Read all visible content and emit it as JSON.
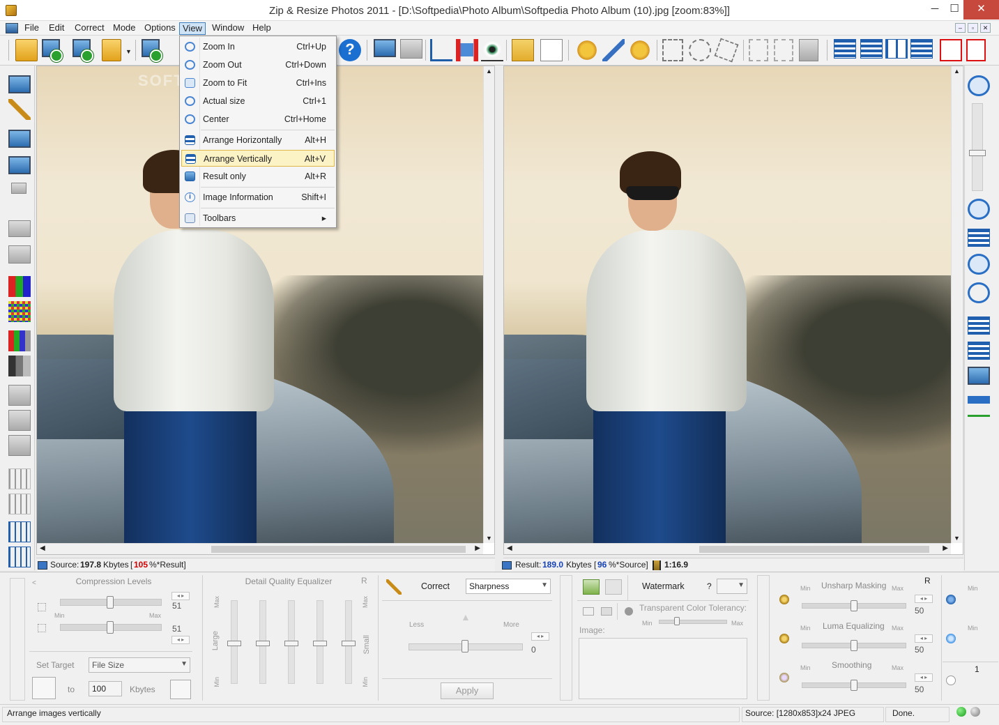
{
  "window": {
    "title": "Zip & Resize Photos 2011 - [D:\\Softpedia\\Photo Album\\Softpedia Photo Album (10).jpg  [zoom:83%]]",
    "minimize": "─",
    "maximize": "☐",
    "close": "✕"
  },
  "menu": [
    "File",
    "Edit",
    "Correct",
    "Mode",
    "Options",
    "View",
    "Window",
    "Help"
  ],
  "mdi_buttons": [
    "–",
    "▫",
    "✕"
  ],
  "view_menu": [
    {
      "label": "Zoom In",
      "shortcut": "Ctrl+Up",
      "icon": "zoom-in-icon"
    },
    {
      "label": "Zoom Out",
      "shortcut": "Ctrl+Down",
      "icon": "zoom-out-icon"
    },
    {
      "label": "Zoom to Fit",
      "shortcut": "Ctrl+Ins",
      "icon": "zoom-fit-icon"
    },
    {
      "label": "Actual size",
      "shortcut": "Ctrl+1",
      "icon": "actual-size-icon"
    },
    {
      "label": "Center",
      "shortcut": "Ctrl+Home",
      "icon": "center-icon"
    },
    {
      "label": "Arrange Horizontally",
      "shortcut": "Alt+H",
      "icon": "arrange-horizontal-icon"
    },
    {
      "label": "Arrange Vertically",
      "shortcut": "Alt+V",
      "icon": "arrange-vertical-icon"
    },
    {
      "label": "Result only",
      "shortcut": "Alt+R",
      "icon": "result-only-icon"
    },
    {
      "label": "Image Information",
      "shortcut": "Shift+I",
      "icon": "info-icon"
    },
    {
      "label": "Toolbars",
      "shortcut": "▸",
      "icon": "toolbars-icon"
    }
  ],
  "watermark_text": "SOFTPEDIA",
  "source_bar": {
    "prefix": "Source:",
    "size": "197.8",
    "unit": "Kbytes",
    "bracket_open": "[",
    "pct": "105",
    "suffix": "%*Result]"
  },
  "result_bar": {
    "prefix": "Result:",
    "size": "189.0",
    "unit": "Kbytes",
    "bracket_open": "[",
    "pct": "96",
    "suffix": "%*Source]",
    "ratio": "1:16.9"
  },
  "compression": {
    "title": "Compression Levels",
    "min": "Min",
    "max": "Max",
    "val1": "51",
    "val2": "51",
    "set_target": "Set Target",
    "target_type": "File Size",
    "to": "to",
    "target_value": "100",
    "unit": "Kbytes"
  },
  "detail_eq": {
    "title": "Detail Quality Equalizer",
    "r": "R",
    "max": "Max",
    "large": "Large",
    "min": "Min",
    "small": "Small"
  },
  "correct": {
    "label": "Correct",
    "option": "Sharpness",
    "less": "Less",
    "more": "More",
    "value": "0",
    "apply": "Apply"
  },
  "watermark": {
    "label": "Watermark",
    "q": "?",
    "tolerance": "Transparent Color Tolerancy:",
    "min": "Min",
    "max": "Max",
    "image": "Image:"
  },
  "filters": {
    "r": "R",
    "unsharp": "Unsharp Masking",
    "luma": "Luma Equalizing",
    "smoothing": "Smoothing",
    "min": "Min",
    "max": "Max",
    "v1": "50",
    "v2": "50",
    "v3": "50"
  },
  "far_right": {
    "min": "Min",
    "one": "1"
  },
  "status": {
    "hint": "Arrange images vertically",
    "source_info": "Source: [1280x853]x24 JPEG",
    "done": "Done."
  }
}
